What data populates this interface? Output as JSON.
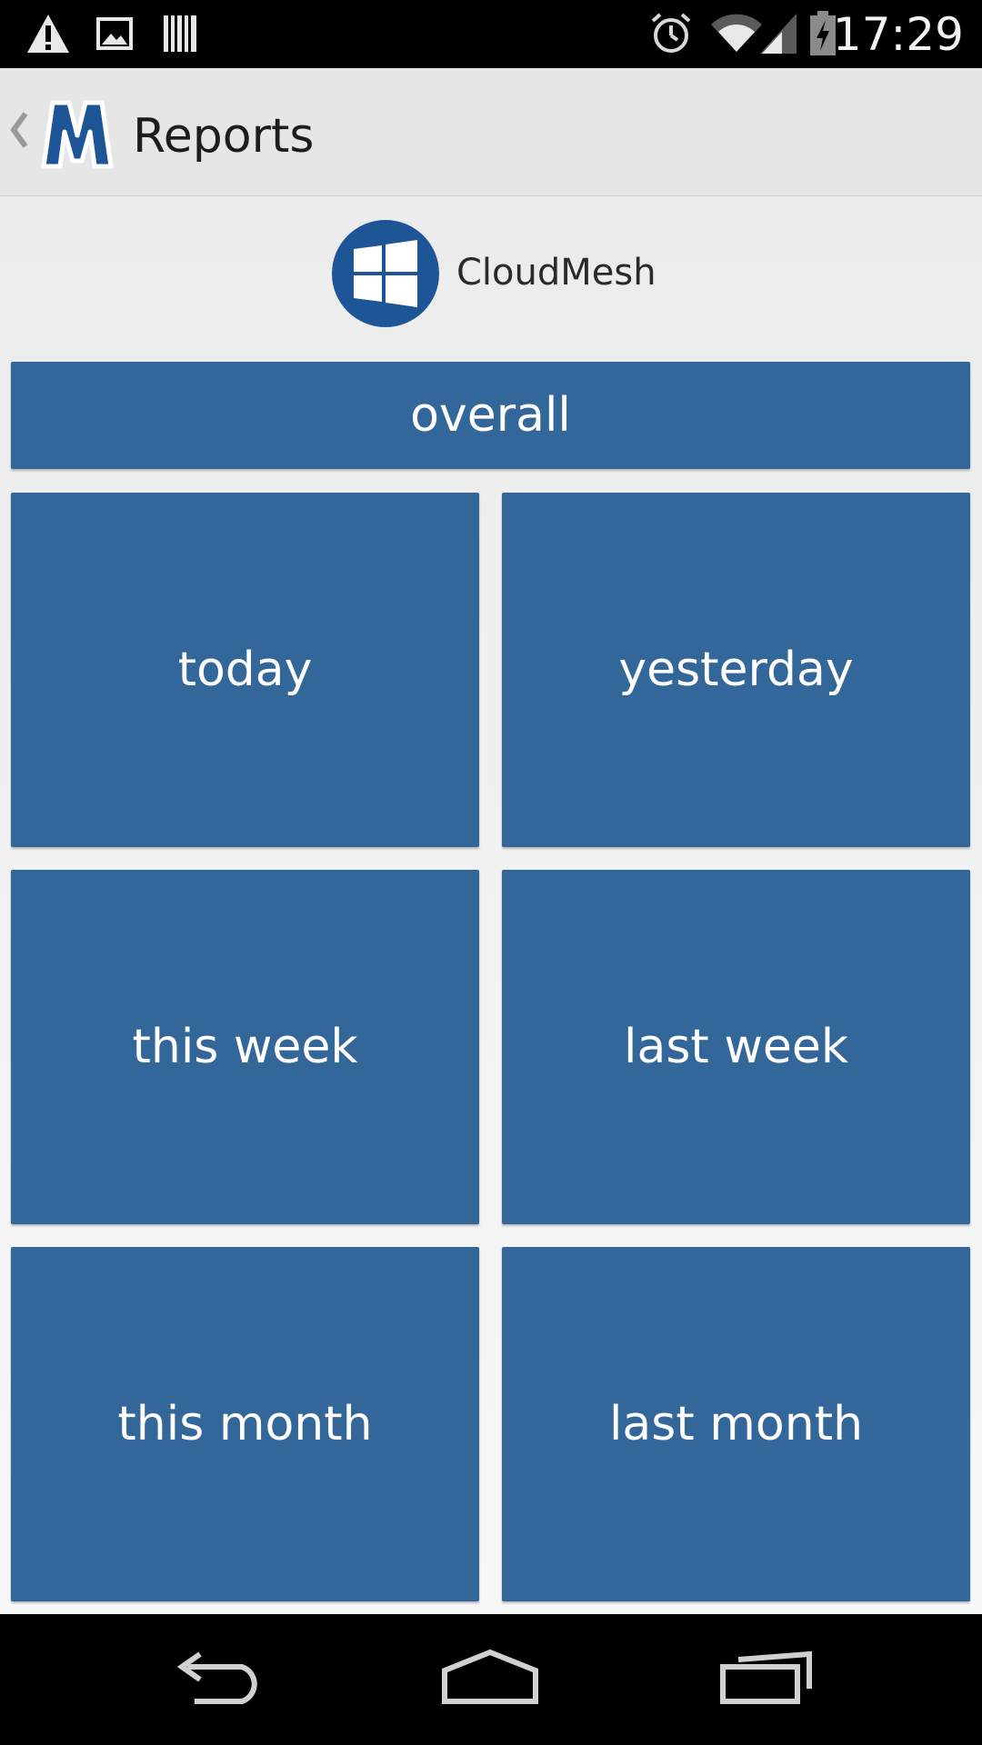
{
  "status_bar": {
    "time": "17:29",
    "icons": [
      "warning-icon",
      "image-icon",
      "barcode-icon",
      "alarm-icon",
      "wifi-icon",
      "signal-icon",
      "battery-charging-icon"
    ]
  },
  "action_bar": {
    "back_icon": "chevron-left-icon",
    "logo_letter": "M",
    "title": "Reports"
  },
  "header": {
    "platform_icon": "windows-icon",
    "name": "CloudMesh"
  },
  "tiles": {
    "overall": "overall",
    "today": "today",
    "yesterday": "yesterday",
    "this_week": "this week",
    "last_week": "last week",
    "this_month": "this month",
    "last_month": "last month"
  },
  "nav_bar": {
    "icons": [
      "back-nav-icon",
      "home-nav-icon",
      "recents-nav-icon"
    ]
  },
  "colors": {
    "tile": "#336699",
    "logo": "#1d5597",
    "background": "#f0f0f0"
  }
}
